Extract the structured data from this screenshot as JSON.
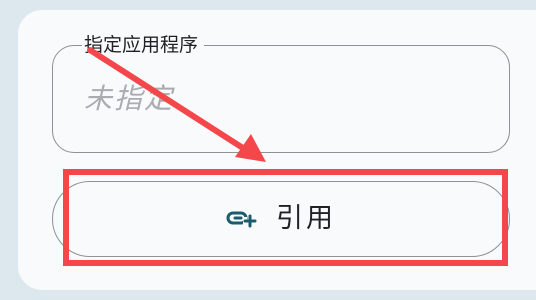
{
  "field": {
    "label": "指定应用程序",
    "placeholder": "未指定"
  },
  "button": {
    "label": "引用",
    "icon": "link-add-icon"
  },
  "colors": {
    "card_background": "#f8fafb",
    "page_background": "#dde8ee",
    "outline": "#8e9294",
    "annotation": "#f4474c",
    "icon": "#1a5c6e"
  }
}
